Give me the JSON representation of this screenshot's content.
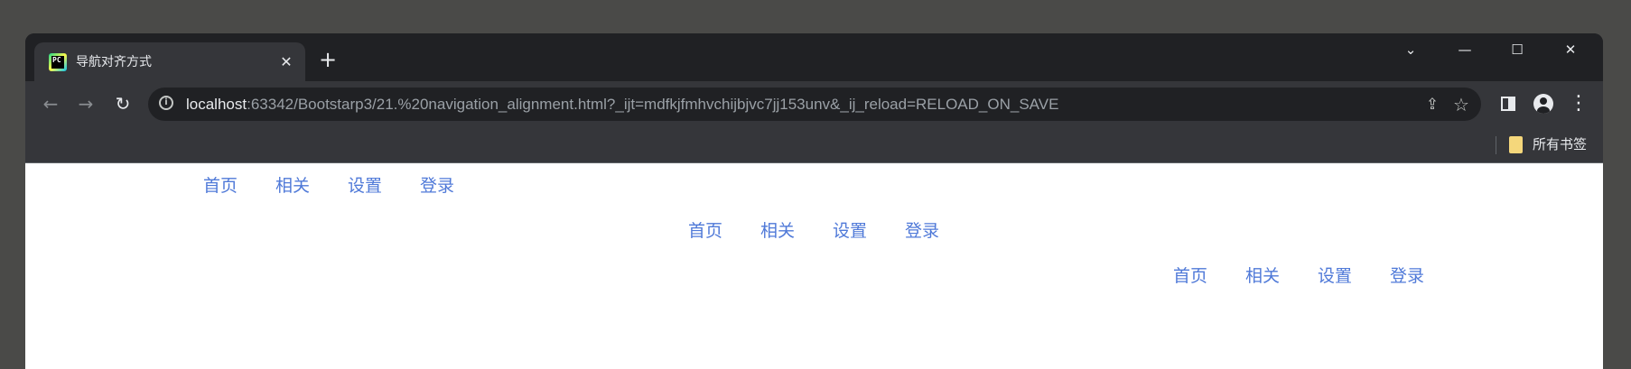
{
  "browser": {
    "tab": {
      "title": "导航对齐方式",
      "favicon_text": "PC",
      "close_glyph": "✕"
    },
    "new_tab_glyph": "+",
    "window_controls": {
      "tab_search": "⌄",
      "minimize": "—",
      "maximize": "☐",
      "close": "✕"
    },
    "nav": {
      "back": "←",
      "forward": "→",
      "reload": "↻"
    },
    "omnibox": {
      "info_glyph": "i",
      "url_host": "localhost",
      "url_rest": ":63342/Bootstarp3/21.%20navigation_alignment.html?_ijt=mdfkjfmhvchijbjvc7jj153unv&_ij_reload=RELOAD_ON_SAVE",
      "share_glyph": "⇪",
      "star_glyph": "☆"
    },
    "menu_glyph": "⋮",
    "bookmarks": {
      "all_bookmarks_label": "所有书签"
    }
  },
  "page": {
    "nav_left": [
      "首页",
      "相关",
      "设置",
      "登录"
    ],
    "nav_center": [
      "首页",
      "相关",
      "设置",
      "登录"
    ],
    "nav_right": [
      "首页",
      "相关",
      "设置",
      "登录"
    ]
  },
  "colors": {
    "link": "#4f79d8",
    "chrome_dark": "#202124",
    "chrome_toolbar": "#35363a",
    "bookmark_folder": "#f5d77b"
  }
}
